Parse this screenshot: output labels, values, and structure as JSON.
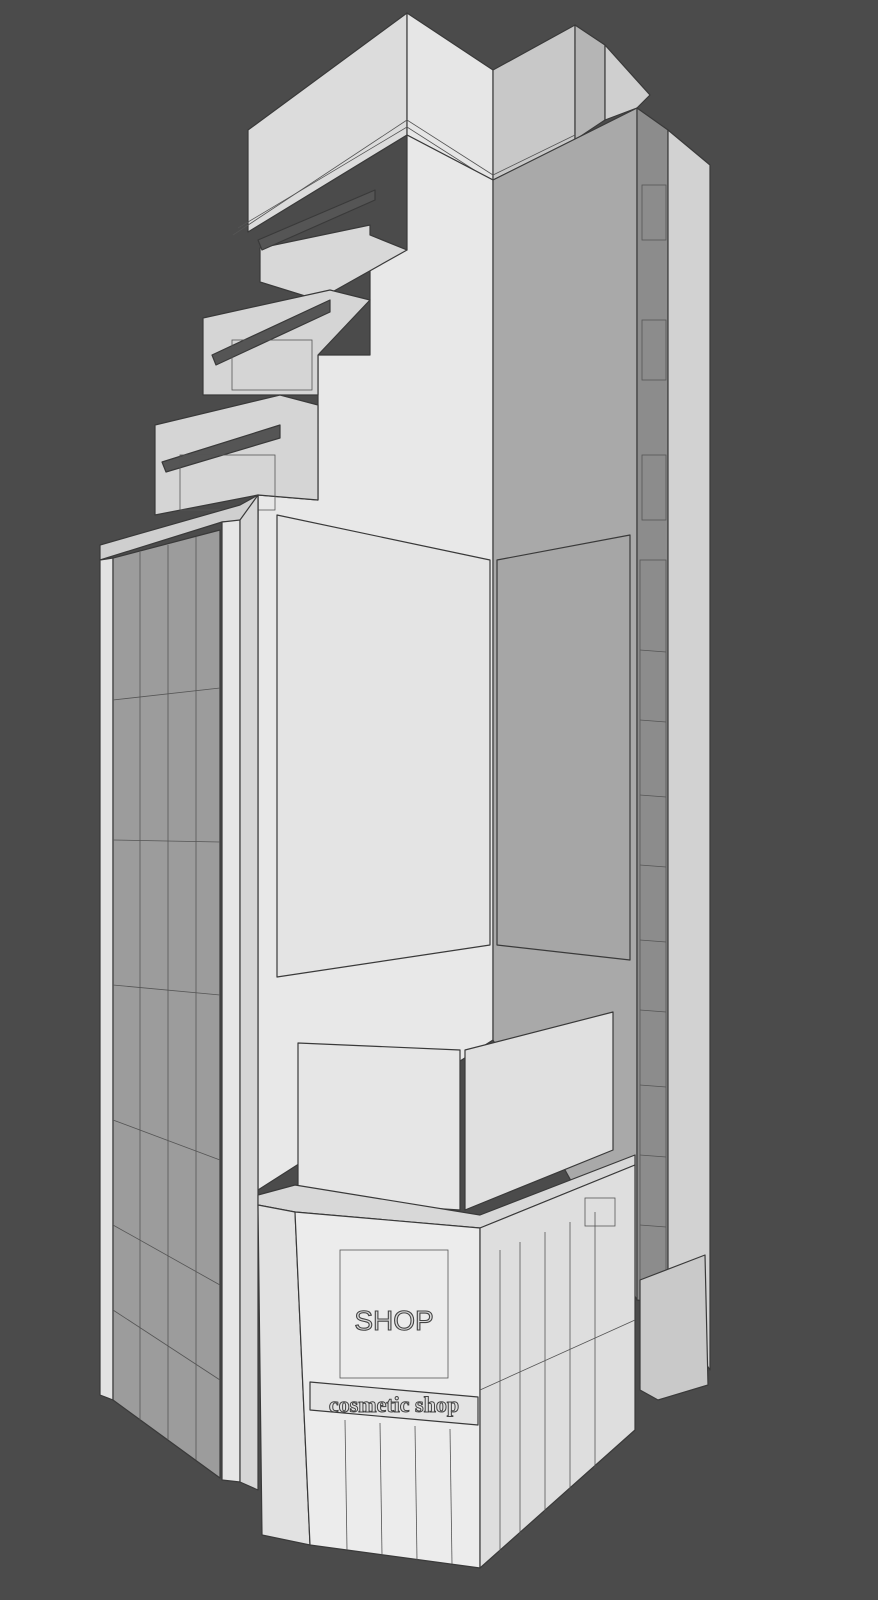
{
  "render": {
    "subject": "3D building model render",
    "background_color": "#4b4b4b"
  },
  "signage": {
    "main_sign": "SHOP",
    "band_sign": "cosmetic shop"
  }
}
